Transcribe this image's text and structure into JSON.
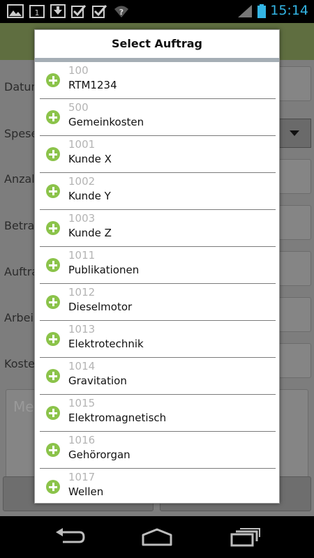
{
  "status_bar": {
    "time": "15:14",
    "icons": [
      "image-icon",
      "calendar-icon",
      "download-icon",
      "checkbox-icon",
      "checkbox-icon",
      "wifi-question-icon",
      "signal-icon",
      "battery-icon"
    ],
    "calendar_day": "1",
    "accent_color": "#33b5e5"
  },
  "background_form": {
    "labels": [
      "Datum",
      "Spese",
      "Anzal",
      "Betra",
      "Auftra",
      "Arbei",
      "Koste"
    ],
    "memo_placeholder": "Me"
  },
  "dialog": {
    "title": "Select Auftrag",
    "items": [
      {
        "code": "100",
        "name": "RTM1234"
      },
      {
        "code": "500",
        "name": "Gemeinkosten"
      },
      {
        "code": "1001",
        "name": "Kunde X"
      },
      {
        "code": "1002",
        "name": "Kunde Y"
      },
      {
        "code": "1003",
        "name": "Kunde Z"
      },
      {
        "code": "1011",
        "name": "Publikationen"
      },
      {
        "code": "1012",
        "name": "Dieselmotor"
      },
      {
        "code": "1013",
        "name": "Elektrotechnik"
      },
      {
        "code": "1014",
        "name": "Gravitation"
      },
      {
        "code": "1015",
        "name": "Elektromagnetisch"
      },
      {
        "code": "1016",
        "name": "Gehörorgan"
      },
      {
        "code": "1017",
        "name": "Wellen"
      }
    ],
    "add_icon_color": "#8bc34a"
  },
  "nav_bar": {
    "buttons": [
      "back-icon",
      "home-icon",
      "recent-apps-icon"
    ]
  }
}
